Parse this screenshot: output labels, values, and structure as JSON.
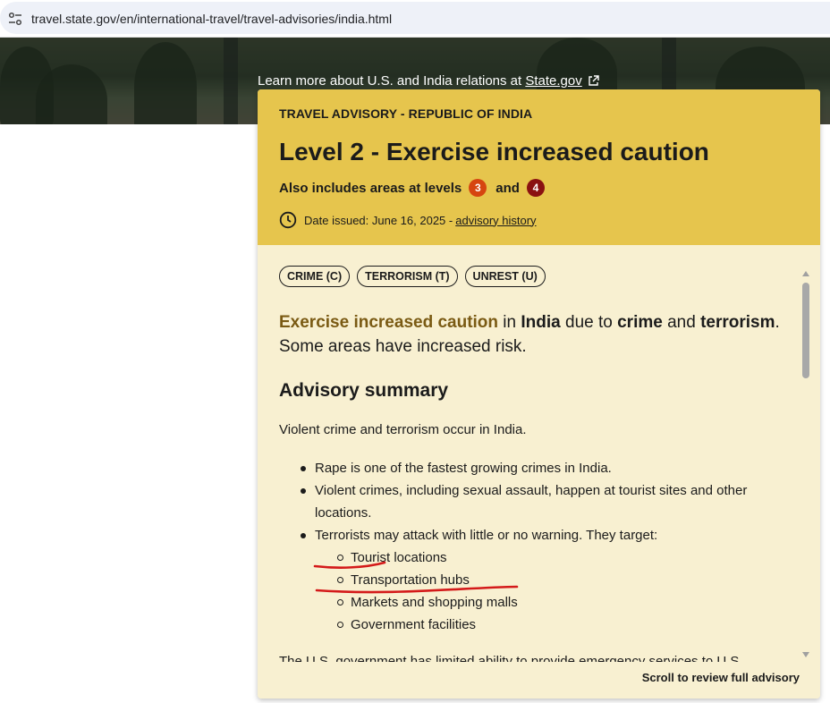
{
  "browser": {
    "url": "travel.state.gov/en/international-travel/travel-advisories/india.html"
  },
  "hero": {
    "relations_text": "Learn more about U.S. and India relations at",
    "relations_link": "State.gov"
  },
  "advisory": {
    "kicker": "TRAVEL ADVISORY - REPUBLIC OF INDIA",
    "level_title": "Level 2 - Exercise increased caution",
    "also_includes": "Also includes areas at levels",
    "level_a": "3",
    "and": "and",
    "level_b": "4",
    "date_issued": "Date issued: June 16, 2025 -",
    "history_link": "advisory history",
    "colors": {
      "header": "#e6c54d",
      "body": "#f8f0d1",
      "level3": "#d64510",
      "level4": "#8a1111",
      "highlight": "#7a5a13"
    },
    "tags": [
      "CRIME (C)",
      "TERRORISM (T)",
      "UNREST (U)"
    ],
    "lead": {
      "highlight": "Exercise increased caution",
      "in": " in ",
      "country": "India",
      "due_to": " due to ",
      "crime": "crime",
      "and": " and ",
      "terrorism": "terrorism",
      "period": ".",
      "second": "Some areas have increased risk."
    },
    "summary_heading": "Advisory summary",
    "intro": "Violent crime and terrorism occur in India.",
    "bullets": [
      "Rape is one of the fastest growing crimes in India.",
      "Violent crimes, including sexual assault, happen at tourist sites and other locations.",
      "Terrorists may attack with little or no warning. They target:"
    ],
    "targets": [
      "Tourist locations",
      "Transportation hubs",
      "Markets and shopping malls",
      "Government facilities"
    ],
    "cut_text": "The U.S. government has limited ability to provide emergency services to U.S.",
    "scroll_hint": "Scroll to review full advisory"
  }
}
